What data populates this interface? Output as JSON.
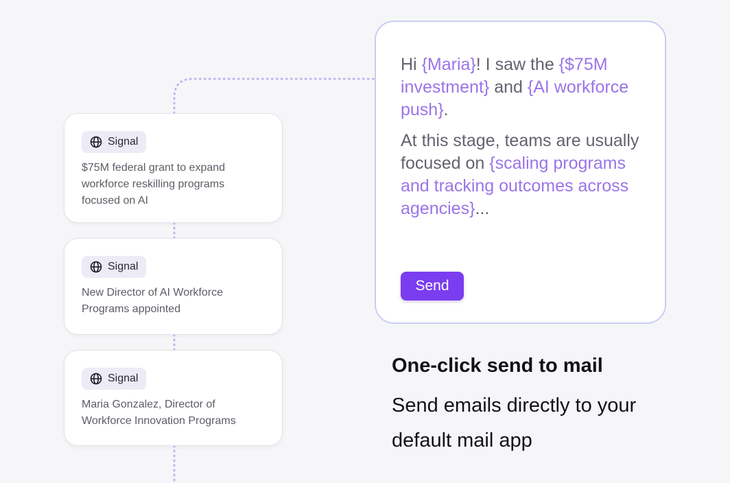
{
  "signals": [
    {
      "badge": "Signal",
      "text": "$75M federal grant to expand workforce reskilling programs focused on AI"
    },
    {
      "badge": "Signal",
      "text": "New Director of AI Workforce Programs appointed"
    },
    {
      "badge": "Signal",
      "text": "Maria Gonzalez, Director of Workforce Innovation Programs"
    }
  ],
  "email": {
    "p1": {
      "t1": "Hi ",
      "v1": "{Maria}",
      "t2": "! I saw the ",
      "v2": "{$75M investment}",
      "t3": " and ",
      "v3": "{AI workforce push}",
      "t4": "."
    },
    "p2": {
      "t1": "At this stage, teams are usually focused on ",
      "v1": "{scaling programs and tracking outcomes across agencies}",
      "t2": "..."
    },
    "send_label": "Send"
  },
  "feature": {
    "title": "One-click send to mail",
    "description": "Send emails directly to your default mail app"
  },
  "colors": {
    "accent": "#7b3df0",
    "variable_text": "#9b74e8",
    "card_border": "#c9cdf2",
    "connector": "#b9b8f2"
  },
  "icons": {
    "badge_icon": "globe-icon"
  }
}
